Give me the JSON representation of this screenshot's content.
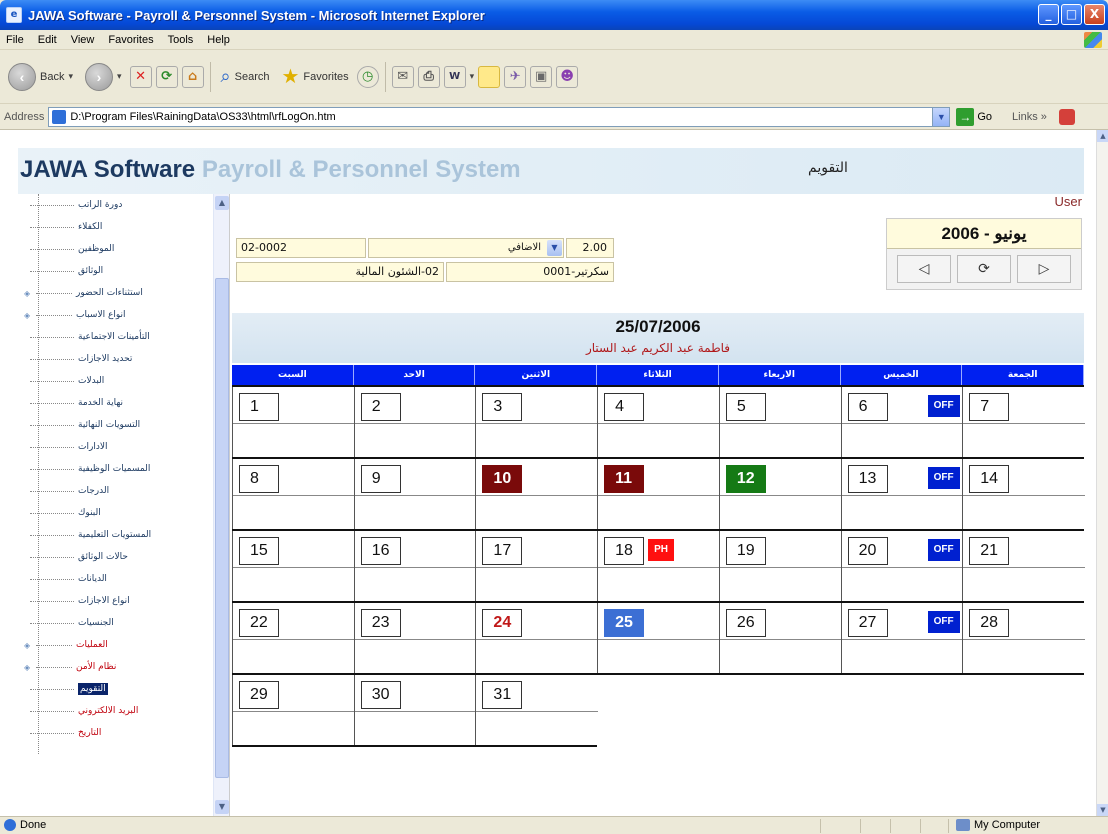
{
  "window": {
    "title": "JAWA Software - Payroll & Personnel System - Microsoft Internet Explorer",
    "controls": {
      "minimize": "_",
      "maximize": "□",
      "close": "X"
    }
  },
  "menubar": [
    "File",
    "Edit",
    "View",
    "Favorites",
    "Tools",
    "Help"
  ],
  "toolbar": {
    "back": "Back",
    "search": "Search",
    "favorites": "Favorites"
  },
  "address": {
    "label": "Address",
    "url": "D:\\Program Files\\RainingData\\OS33\\html\\rfLogOn.htm",
    "go": "Go",
    "links": "Links"
  },
  "app": {
    "brand_main": "JAWA Software",
    "brand_sub": "Payroll & Personnel System",
    "header_title": "التقويم",
    "user": "User"
  },
  "sidebar": {
    "items": [
      {
        "label": "دورة الراتب",
        "red": false,
        "expandable": false
      },
      {
        "label": "الكفلاء",
        "red": false,
        "expandable": false
      },
      {
        "label": "الموظفين",
        "red": false,
        "expandable": false
      },
      {
        "label": "الوثائق",
        "red": false,
        "expandable": false
      },
      {
        "label": "استثناءات الحضور",
        "red": false,
        "expandable": true
      },
      {
        "label": "انواع الاسباب",
        "red": false,
        "expandable": true
      },
      {
        "label": "التأمينات الاجتماعية",
        "red": false,
        "expandable": false
      },
      {
        "label": "تحديد الاجازات",
        "red": false,
        "expandable": false
      },
      {
        "label": "البدلات",
        "red": false,
        "expandable": false
      },
      {
        "label": "نهاية الخدمة",
        "red": false,
        "expandable": false
      },
      {
        "label": "التسويات النهائية",
        "red": false,
        "expandable": false
      },
      {
        "label": "الادارات",
        "red": false,
        "expandable": false
      },
      {
        "label": "المسميات الوظيفية",
        "red": false,
        "expandable": false
      },
      {
        "label": "الدرجات",
        "red": false,
        "expandable": false
      },
      {
        "label": "البنوك",
        "red": false,
        "expandable": false
      },
      {
        "label": "المستويات التعليمية",
        "red": false,
        "expandable": false
      },
      {
        "label": "حالات الوثائق",
        "red": false,
        "expandable": false
      },
      {
        "label": "الديانات",
        "red": false,
        "expandable": false
      },
      {
        "label": "انواع الاجازات",
        "red": false,
        "expandable": false
      },
      {
        "label": "الجنسيات",
        "red": false,
        "expandable": false
      },
      {
        "label": "العمليات",
        "red": true,
        "expandable": true
      },
      {
        "label": "نظام الأمن",
        "red": true,
        "expandable": true
      },
      {
        "label": "التقويم",
        "red": false,
        "expandable": false,
        "selected": true
      },
      {
        "label": "البريد الالكتروني",
        "red": true,
        "expandable": false
      },
      {
        "label": "التاريخ",
        "red": true,
        "expandable": false
      }
    ]
  },
  "form": {
    "employee_code": "02-0002",
    "type_select": "الاضافي",
    "hours": "2.00",
    "department": "02-الشئون المالية",
    "position": "سكرتير-0001"
  },
  "calendar_widget": {
    "month_label": "يونيو - 2006",
    "prev": "◁",
    "refresh": "⟳",
    "next": "▷"
  },
  "calendar": {
    "date": "25/07/2006",
    "employee_name": "فاطمة عبد الكريم عبد الستار",
    "weekdays": [
      "السبت",
      "الاحد",
      "الاثنين",
      "الثلاثاء",
      "الاربعاء",
      "الخميس",
      "الجمعة"
    ],
    "off_label": "OFF",
    "ph_label": "PH",
    "rows": [
      [
        {
          "d": "1"
        },
        {
          "d": "2"
        },
        {
          "d": "3"
        },
        {
          "d": "4"
        },
        {
          "d": "5"
        },
        {
          "d": "6",
          "off": true
        },
        {
          "d": "7"
        }
      ],
      [
        {
          "d": "8"
        },
        {
          "d": "9"
        },
        {
          "d": "10",
          "style": "dark-red"
        },
        {
          "d": "11",
          "style": "dark-red"
        },
        {
          "d": "12",
          "style": "green"
        },
        {
          "d": "13",
          "off": true
        },
        {
          "d": "14"
        }
      ],
      [
        {
          "d": "15"
        },
        {
          "d": "16"
        },
        {
          "d": "17"
        },
        {
          "d": "18",
          "ph": true
        },
        {
          "d": "19"
        },
        {
          "d": "20",
          "off": true
        },
        {
          "d": "21"
        }
      ],
      [
        {
          "d": "22"
        },
        {
          "d": "23"
        },
        {
          "d": "24",
          "style": "red-text"
        },
        {
          "d": "25",
          "style": "blue"
        },
        {
          "d": "26"
        },
        {
          "d": "27",
          "off": true
        },
        {
          "d": "28"
        }
      ],
      [
        {
          "d": "29"
        },
        {
          "d": "30"
        },
        {
          "d": "31"
        }
      ]
    ]
  },
  "statusbar": {
    "left": "Done",
    "right": "My Computer"
  }
}
